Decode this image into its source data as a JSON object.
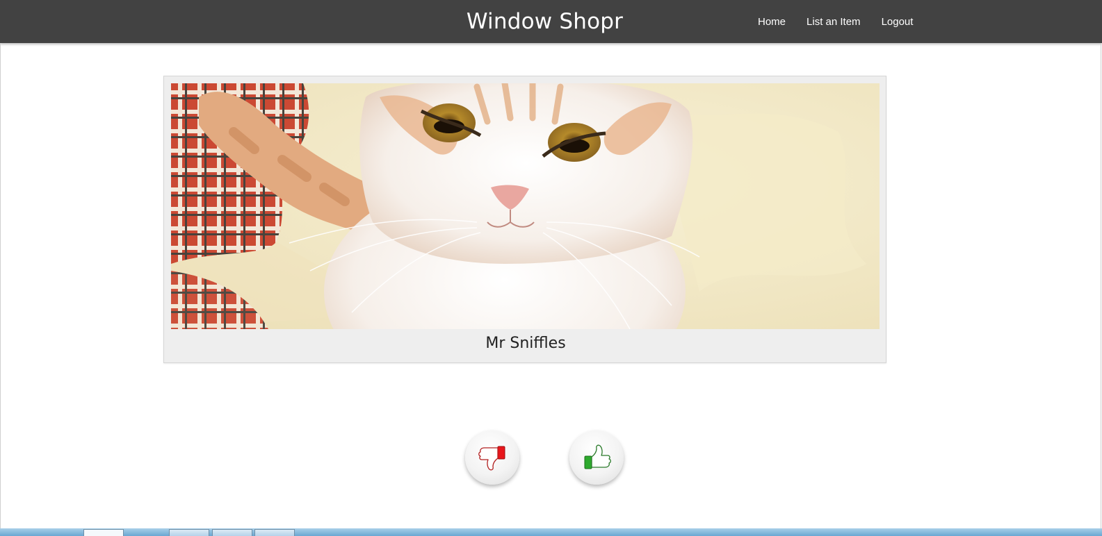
{
  "header": {
    "title": "Window Shopr",
    "nav": [
      {
        "label": "Home"
      },
      {
        "label": "List an Item"
      },
      {
        "label": "Logout"
      }
    ]
  },
  "item": {
    "name": "Mr Sniffles",
    "image_icon": "cat-photo"
  },
  "actions": {
    "dislike_icon": "thumbs-down-icon",
    "like_icon": "thumbs-up-icon"
  },
  "colors": {
    "navbar": "#424242",
    "card": "#eeeeee",
    "dislike_accent": "#e8161b",
    "like_accent": "#2eaa2e"
  }
}
